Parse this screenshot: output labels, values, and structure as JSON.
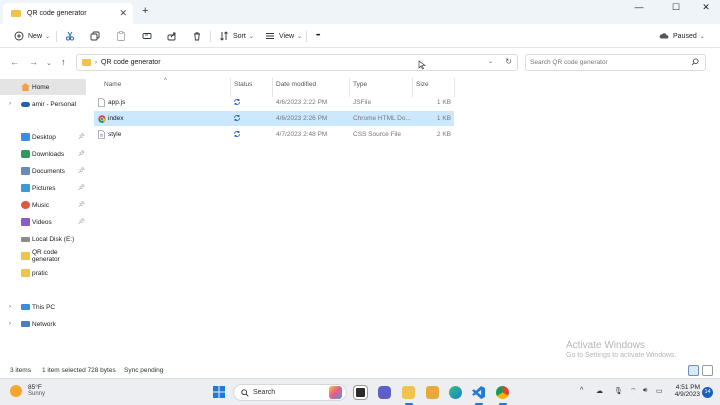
{
  "window": {
    "tab_title": "QR code generator",
    "tab_close": "✕",
    "new_tab": "+",
    "minimize": "—",
    "maximize": "☐",
    "close": "✕"
  },
  "commandbar": {
    "new_label": "New",
    "sort_label": "Sort",
    "view_label": "View",
    "more_label": "•••",
    "paused_label": "Paused"
  },
  "address": {
    "crumb": "QR code generator",
    "search_placeholder": "Search QR code generator"
  },
  "navpane": {
    "items": [
      {
        "label": "Home",
        "selected": true,
        "icon": "home-icon"
      },
      {
        "label": "amir - Personal",
        "icon": "cloud-icon"
      },
      {
        "label": "Desktop",
        "icon": "desktop-icon",
        "pinned": true
      },
      {
        "label": "Downloads",
        "icon": "downloads-icon",
        "pinned": true
      },
      {
        "label": "Documents",
        "icon": "documents-icon",
        "pinned": true
      },
      {
        "label": "Pictures",
        "icon": "pictures-icon",
        "pinned": true
      },
      {
        "label": "Music",
        "icon": "music-icon",
        "pinned": true
      },
      {
        "label": "Videos",
        "icon": "videos-icon",
        "pinned": true
      },
      {
        "label": "Local Disk (E:)",
        "icon": "drive-icon"
      },
      {
        "label": "QR code generator",
        "icon": "folder-icon"
      },
      {
        "label": "pratic",
        "icon": "folder-icon"
      },
      {
        "label": "This PC",
        "icon": "pc-icon"
      },
      {
        "label": "Network",
        "icon": "network-icon"
      }
    ]
  },
  "columns": {
    "name": "Name",
    "status": "Status",
    "date": "Date modified",
    "type": "Type",
    "size": "Size"
  },
  "files": [
    {
      "name": "app.js",
      "date": "4/6/2023 2:22 PM",
      "type": "JSFile",
      "size": "1 KB",
      "icon": "js-file-icon"
    },
    {
      "name": "index",
      "date": "4/6/2023 2:26 PM",
      "type": "Chrome HTML Do...",
      "size": "1 KB",
      "selected": true,
      "icon": "chrome-html-icon"
    },
    {
      "name": "style",
      "date": "4/7/2023 2:48 PM",
      "type": "CSS Source File",
      "size": "2 KB",
      "icon": "css-file-icon"
    }
  ],
  "watermark": {
    "line1": "Activate Windows",
    "line2": "Go to Settings to activate Windows."
  },
  "statusbar": {
    "items": "3 items",
    "selected": "1 item selected  728 bytes",
    "sync": "Sync pending"
  },
  "taskbar": {
    "temperature": "85°F",
    "condition": "Sunny",
    "search_placeholder": "Search",
    "time": "4:51 PM",
    "date": "4/9/2023",
    "notifications": "14"
  },
  "colors": {
    "accent": "#0067c0",
    "selection": "#cce8ff",
    "folder": "#f0c44c"
  }
}
